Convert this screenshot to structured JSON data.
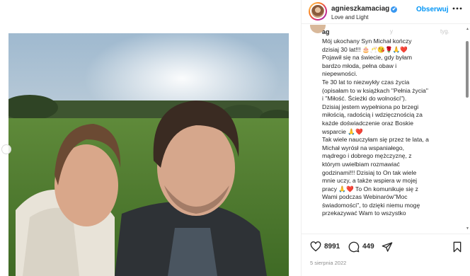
{
  "header": {
    "username": "agnieszkamaciag",
    "verified_glyph": "✔",
    "subtitle": "Love and Light",
    "follow_label": "Obserwuj",
    "more_icon": "more-dots-icon"
  },
  "caption": {
    "user": "ag",
    "faded_text": "y",
    "faded_text2": "tyg.",
    "text": "Mój ukochany Syn Michał kończy\ndzisiaj 30 lat!!! 🎂🥂😘🌹🙏❤️\nPojawił się na świecie, gdy byłam\nbardzo młoda, pełna obaw i\nniepewności.\nTe 30 lat to niezwykły czas życia\n(opisałam to w książkach \"Pełnia życia\"\ni \"Miłość. Ścieżki do wolności\").\nDzisiaj jestem wypełniona po brzegi\nmiłością, radością i wdzięcznością za\nkażde doświadczenie oraz Boskie\nwsparcie 🙏❤️\nTak wiele nauczyłam się przez te lata, a\nMichał wyrósł na wspaniałego,\nmądrego i dobrego mężczyznę, z\nktórym uwielbiam rozmawiać\ngodzinami!!! Dzisiaj to On tak wiele\nmnie uczy, a także wspiera w mojej\npracy 🙏❤️ To On komunikuje się z\nWami podczas Webinarów\"Moc\nświadomości\", to dzięki niemu mogę\nprzekazywać Wam to wszystko"
  },
  "actions": {
    "likes": "8991",
    "comments": "449",
    "date": "5 sierpnia 2022"
  },
  "colors": {
    "accent": "#0095f6",
    "verified": "#3897f0"
  }
}
